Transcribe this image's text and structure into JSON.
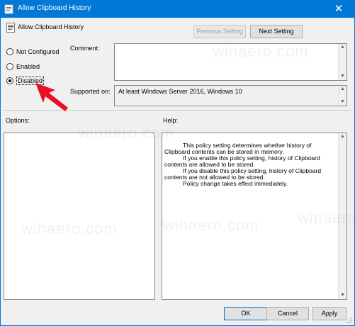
{
  "window": {
    "title": "Allow Clipboard History",
    "close_glyph": "✕"
  },
  "header": {
    "policy_title": "Allow Clipboard History"
  },
  "nav": {
    "previous_label": "Previous Setting",
    "next_label": "Next Setting"
  },
  "state": {
    "options": [
      {
        "label": "Not Configured",
        "checked": false
      },
      {
        "label": "Enabled",
        "checked": false
      },
      {
        "label": "Disabled",
        "checked": true
      }
    ]
  },
  "comment": {
    "label": "Comment:",
    "value": ""
  },
  "supported": {
    "label": "Supported on:",
    "value": "At least Windows Server 2016, Windows 10"
  },
  "options_panel": {
    "label": "Options:"
  },
  "help_panel": {
    "label": "Help:",
    "paragraphs": [
      "This policy setting determines whether history of Clipboard contents can be stored in memory.",
      "If you enable this policy setting, history of Clipboard contents are allowed to be stored.",
      "If you disable this policy setting, history of Clipboard contents are not allowed to be stored.",
      "Policy change takes effect immediately."
    ]
  },
  "footer": {
    "ok_label": "OK",
    "cancel_label": "Cancel",
    "apply_label": "Apply"
  },
  "watermark": {
    "text": "winaero.com"
  },
  "annotation": {
    "arrow_color": "#e81123"
  },
  "colors": {
    "titlebar": "#0078d7",
    "window_bg": "#f0f0f0"
  }
}
